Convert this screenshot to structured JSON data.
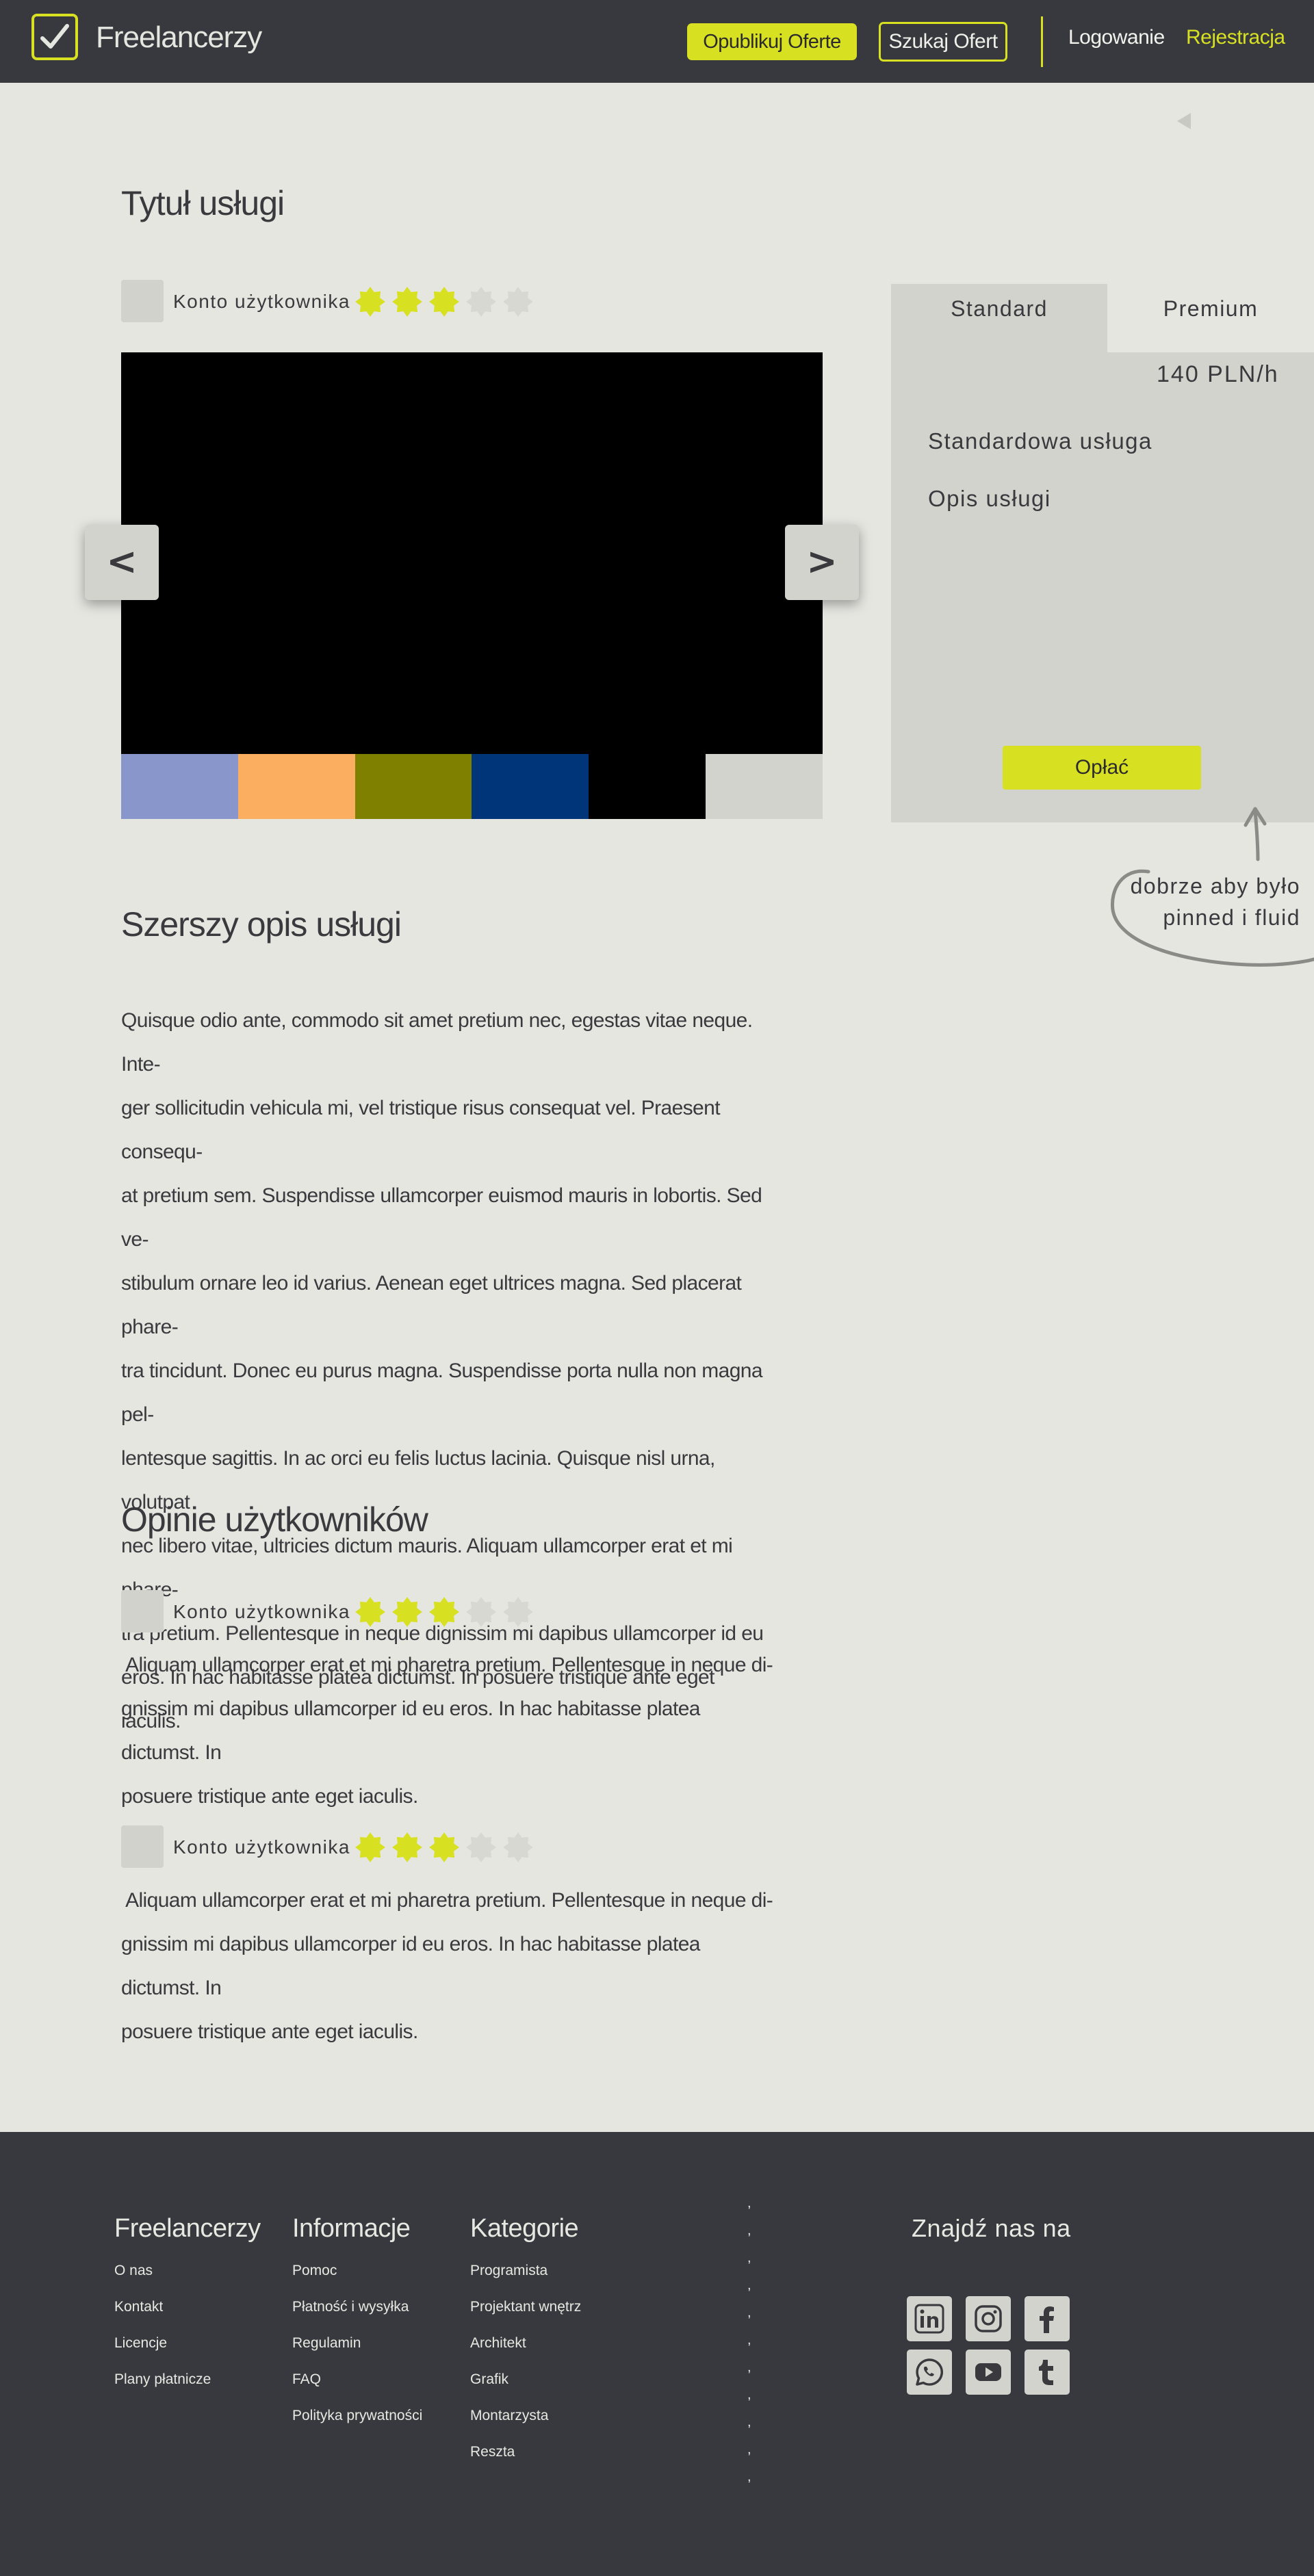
{
  "header": {
    "logo_text": "Freelancerzy",
    "publish_button": "Opublikuj Oferte",
    "search_button": "Szukaj Ofert",
    "login_link": "Logowanie",
    "register_link": "Rejestracja"
  },
  "service": {
    "title": "Tytuł usługi",
    "account_label": "Konto użytkownika",
    "rating": 3,
    "rating_max": 5,
    "gallery": {
      "prev_label": "<",
      "next_label": ">",
      "thumb_colors": [
        "#8996cb",
        "#fbae5f",
        "#808000",
        "#003579",
        "#000000",
        "#d3d3cd"
      ]
    }
  },
  "pricing": {
    "tabs": [
      {
        "label": "Standard",
        "active": true
      },
      {
        "label": "Premium",
        "active": false
      }
    ],
    "price": "140 PLN/h",
    "plan_name": "Standardowa usługa",
    "plan_desc": "Opis usługi",
    "pay_button": "Opłać"
  },
  "annotation": {
    "line1": "dobrze aby było",
    "line2": "pinned i fluid"
  },
  "description": {
    "title": "Szerszy opis usługi",
    "lines": [
      "Quisque odio ante, commodo sit amet pretium nec, egestas vitae neque. Inte-",
      "ger sollicitudin vehicula mi, vel tristique risus consequat vel. Praesent consequ-",
      "at pretium sem. Suspendisse ullamcorper euismod mauris in lobortis. Sed ve-",
      "stibulum ornare leo id varius. Aenean eget ultrices magna. Sed placerat phare-",
      "tra tincidunt. Donec eu purus magna. Suspendisse porta nulla non magna pel-",
      "lentesque sagittis. In ac orci eu felis luctus lacinia. Quisque nisl urna, volutpat",
      "nec libero vitae, ultricies dictum mauris. Aliquam ullamcorper erat et mi phare-",
      "tra pretium. Pellentesque in neque dignissim mi dapibus ullamcorper id eu",
      "eros. In hac habitasse platea dictumst. In posuere tristique ante eget iaculis."
    ]
  },
  "reviews": {
    "title": "Opinie użytkowników",
    "items": [
      {
        "account_label": "Konto użytkownika",
        "rating": 3,
        "lines": [
          " Aliquam ullamcorper erat et mi pharetra pretium. Pellentesque in neque di-",
          "gnissim mi dapibus ullamcorper id eu eros. In hac habitasse platea dictumst. In",
          "posuere tristique ante eget iaculis."
        ]
      },
      {
        "account_label": "Konto użytkownika",
        "rating": 3,
        "lines": [
          " Aliquam ullamcorper erat et mi pharetra pretium. Pellentesque in neque di-",
          "gnissim mi dapibus ullamcorper id eu eros. In hac habitasse platea dictumst. In",
          "posuere tristique ante eget iaculis."
        ]
      }
    ]
  },
  "footer": {
    "columns": [
      {
        "title": "Freelancerzy",
        "links": [
          "O nas",
          "Kontakt",
          "Licencje",
          "Plany płatnicze"
        ]
      },
      {
        "title": "Informacje",
        "links": [
          "Pomoc",
          "Płatność i wysyłka",
          "Regulamin",
          "FAQ",
          "Polityka prywatności"
        ]
      },
      {
        "title": "Kategorie",
        "links": [
          "Programista",
          "Projektant wnętrz",
          "Architekt",
          "Grafik",
          "Montarzysta",
          "Reszta"
        ]
      }
    ],
    "dots": [
      ",",
      ",",
      ",",
      ",",
      ",",
      ",",
      ",",
      ",",
      ",",
      ",",
      ","
    ],
    "social_title": "Znajdź nas na",
    "social_icons": [
      "linkedin-icon",
      "instagram-icon",
      "facebook-icon",
      "whatsapp-icon",
      "youtube-icon",
      "tumblr-icon"
    ]
  },
  "colors": {
    "accent": "#d8e022",
    "dark": "#38393e",
    "background": "#e6e6e1",
    "panel": "#d3d3cd",
    "star_empty": "#d8d8d2"
  }
}
